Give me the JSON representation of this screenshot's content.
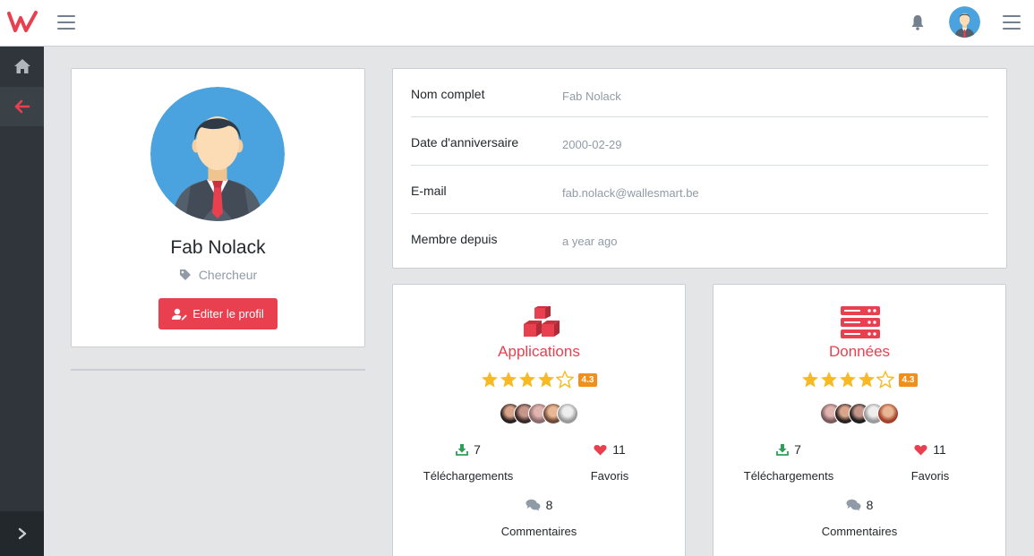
{
  "colors": {
    "accent": "#e8404f",
    "sidebar": "#2f353a",
    "star": "#f7b924",
    "badge": "#f0901a",
    "download": "#2e9e58"
  },
  "topbar": {
    "logo_icon": "w-logo-icon",
    "menu_icon": "hamburger-icon",
    "notification_icon": "bell-icon",
    "user_avatar": "user-avatar",
    "right_menu_icon": "hamburger-icon"
  },
  "sidebar": {
    "items": [
      {
        "icon": "home-icon"
      },
      {
        "icon": "arrow-left-icon"
      }
    ],
    "minimizer_icon": "chevron-right-icon"
  },
  "profile": {
    "name": "Fab Nolack",
    "role": "Chercheur",
    "role_icon": "tag-icon",
    "edit_label": "Editer le profil",
    "edit_icon": "user-edit-icon"
  },
  "info": {
    "rows": [
      {
        "label": "Nom complet",
        "value": "Fab Nolack"
      },
      {
        "label": "Date d'anniversaire",
        "value": "2000-02-29"
      },
      {
        "label": "E-mail",
        "value": "fab.nolack@wallesmart.be"
      },
      {
        "label": "Membre depuis",
        "value": "a year ago"
      }
    ]
  },
  "stats": [
    {
      "title": "Applications",
      "icon": "cubes-icon",
      "rating": 4.3,
      "rating_label": "4.3",
      "downloads": "7",
      "downloads_label": "Téléchargements",
      "favorites": "11",
      "favorites_label": "Favoris",
      "comments": "8",
      "comments_label": "Commentaires"
    },
    {
      "title": "Données",
      "icon": "server-icon",
      "rating": 4.3,
      "rating_label": "4.3",
      "downloads": "7",
      "downloads_label": "Téléchargements",
      "favorites": "11",
      "favorites_label": "Favoris",
      "comments": "8",
      "comments_label": "Commentaires"
    }
  ]
}
